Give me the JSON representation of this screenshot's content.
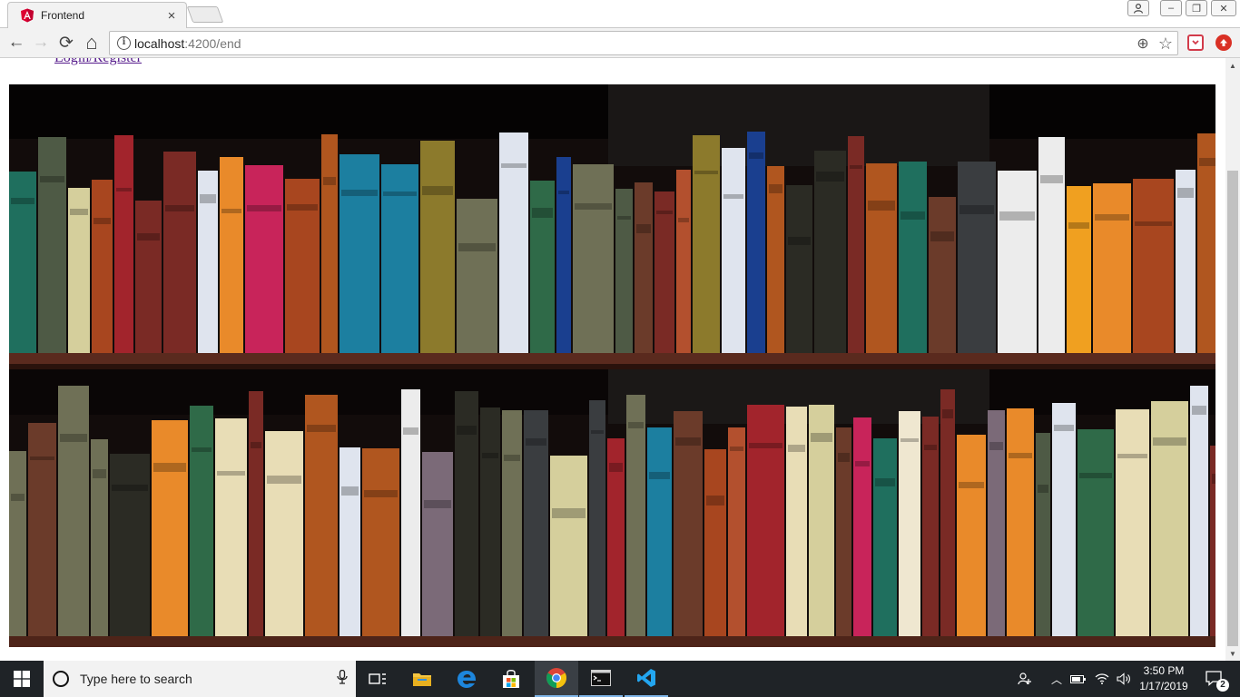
{
  "tab": {
    "title": "Frontend",
    "close_label": "×"
  },
  "window_controls": {
    "profile": "profile-icon",
    "minimize": "–",
    "restore": "❐",
    "close": "✕"
  },
  "toolbar": {
    "back": "←",
    "forward": "→",
    "reload": "⟳",
    "home": "⌂",
    "url_host": "localhost",
    "url_path": ":4200/end",
    "zoom_icon": "⊕",
    "star_icon": "☆"
  },
  "page": {
    "top_link": "Login/Register",
    "image_alt": "bookshelf"
  },
  "taskbar": {
    "search_placeholder": "Type here to search",
    "time": "3:50 PM",
    "date": "1/17/2019",
    "notification_count": "2"
  },
  "colors": {
    "accent": "#7fb5e8",
    "taskbar_bg": "#1f2327",
    "link": "#551a8b",
    "angular_red": "#dd0031"
  }
}
